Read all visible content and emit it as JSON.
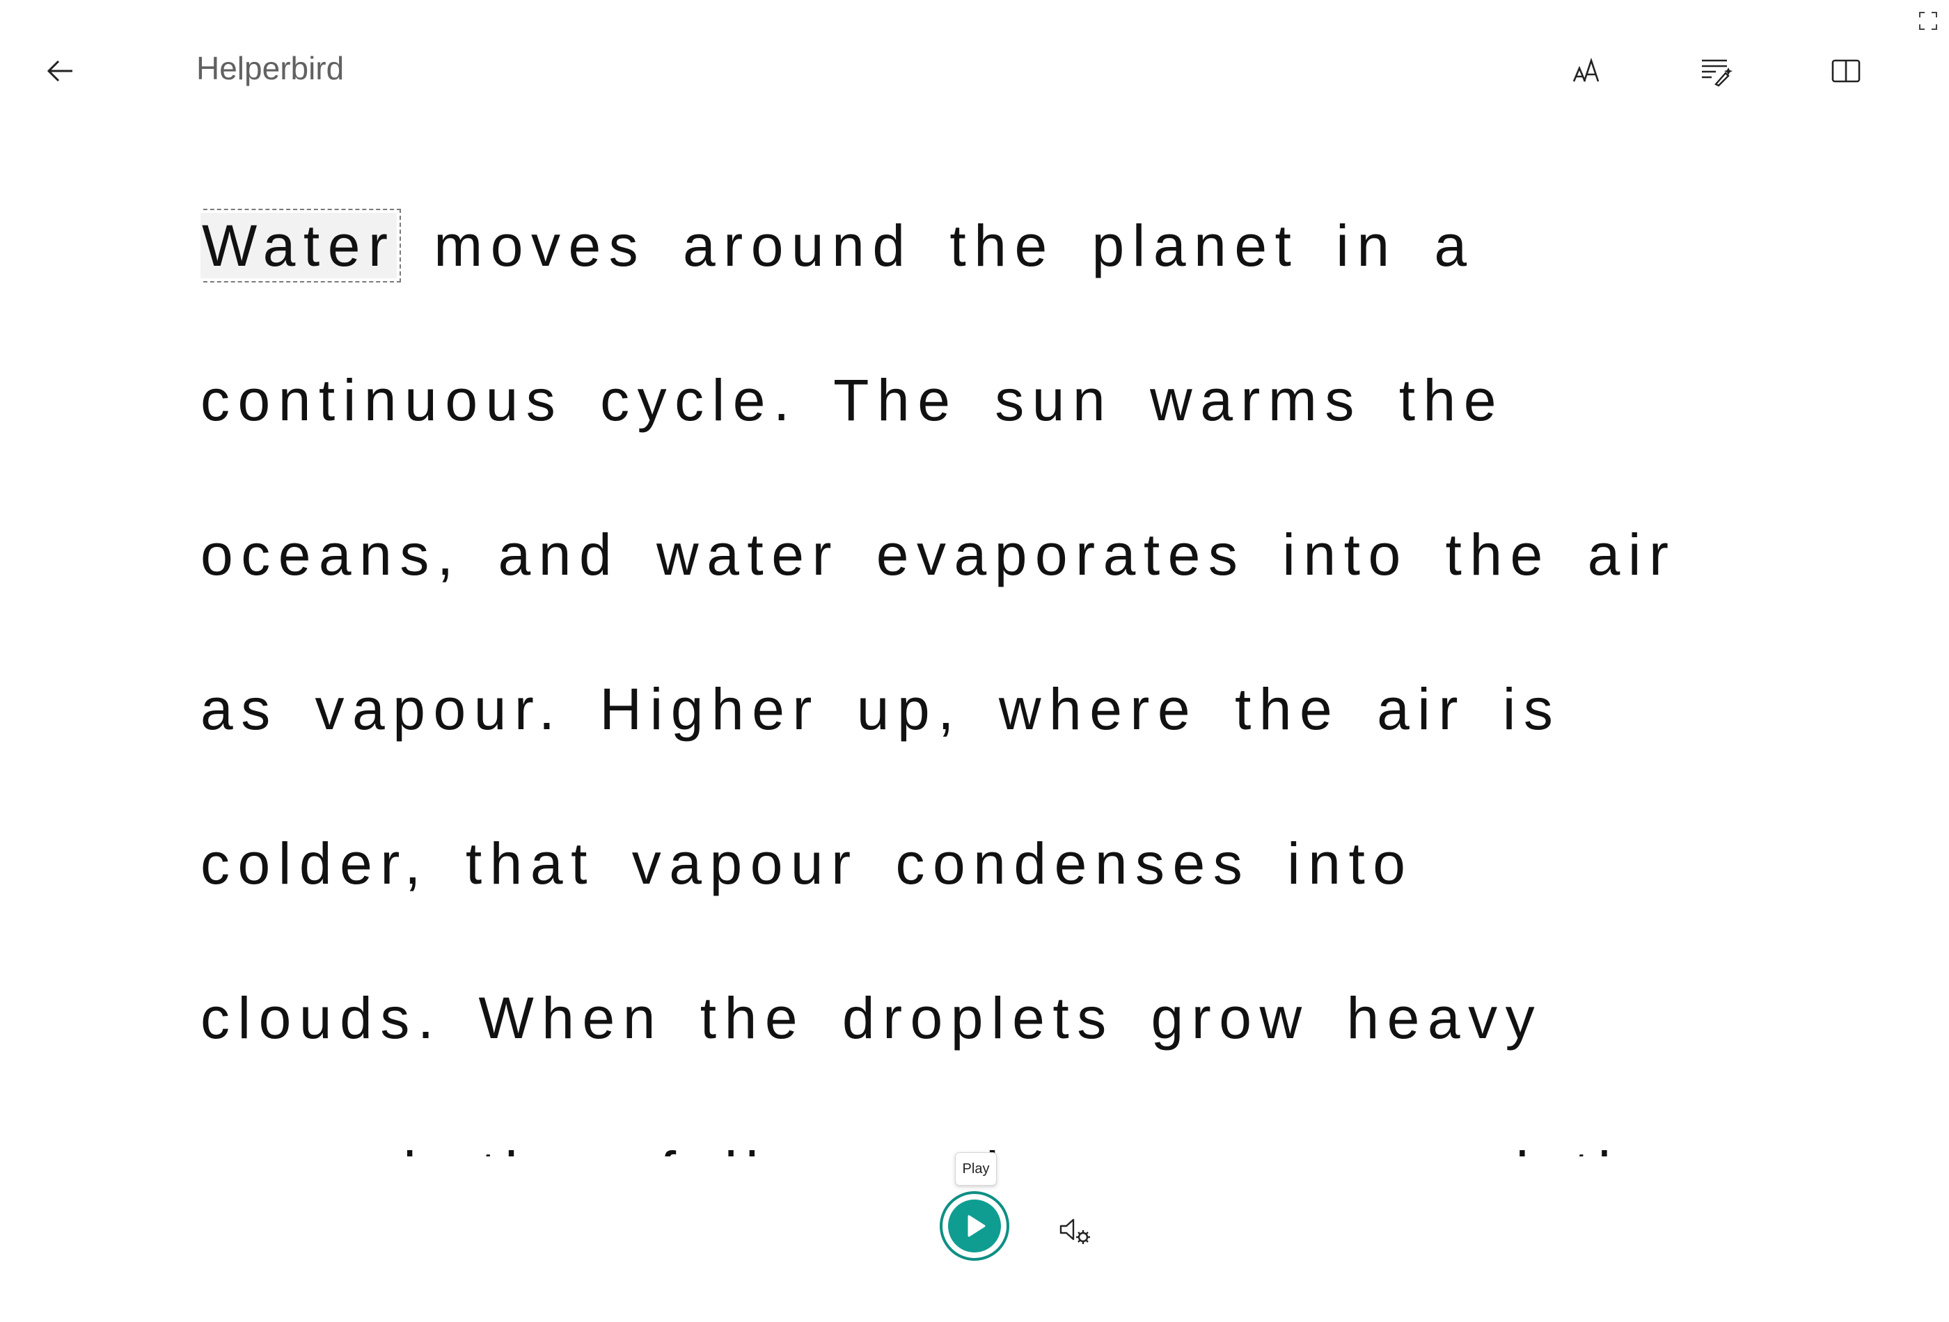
{
  "app": {
    "title": "Helperbird"
  },
  "toolbar": {
    "back_icon": "arrow-left-icon",
    "text_preferences_icon": "text-size-icon",
    "grammar_icon": "grammar-tools-icon",
    "reading_preferences_icon": "reading-preferences-icon",
    "fullscreen_icon": "fullscreen-icon"
  },
  "reader": {
    "highlighted_word": "Water",
    "first_line_rest": " moves around the planet in a",
    "lines": [
      "continuous cycle. The sun warms the",
      "oceans, and water evaporates into the air",
      "as vapour. Higher up, where the air is",
      "colder, that vapour condenses into",
      "clouds. When the droplets grow heavy",
      "enough they fall as rain or snow, and the"
    ]
  },
  "playback": {
    "tooltip": "Play",
    "play_icon": "play-icon",
    "voice_settings_icon": "voice-settings-icon",
    "accent_color": "#0f9d91"
  }
}
